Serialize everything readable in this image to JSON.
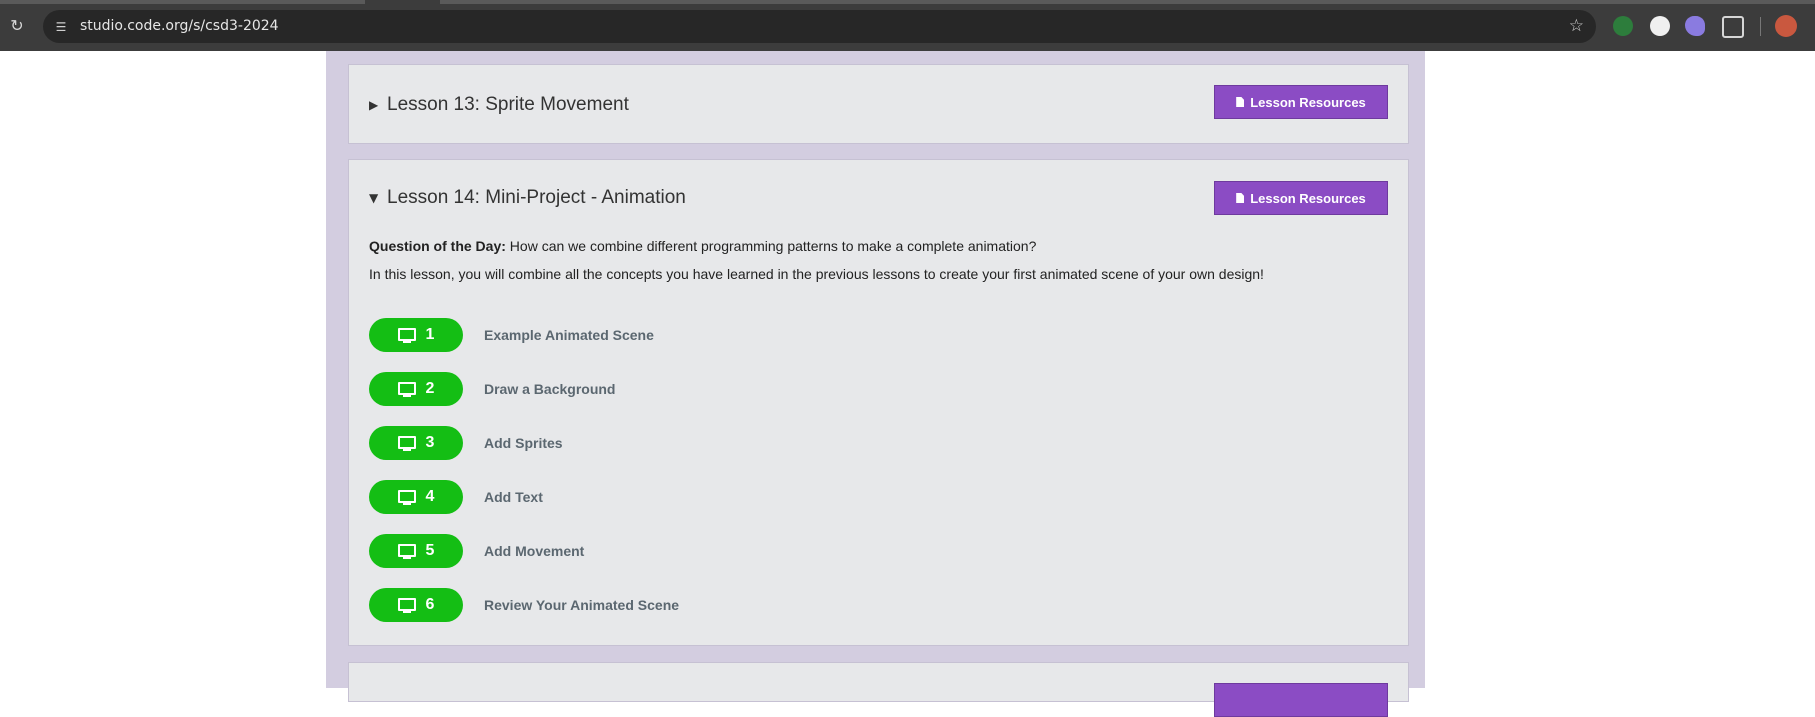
{
  "browser": {
    "url": "studio.code.org/s/csd3-2024"
  },
  "lessons": [
    {
      "title": "Lesson 13: Sprite Movement",
      "expanded": false,
      "resources_label": "Lesson Resources"
    },
    {
      "title": "Lesson 14: Mini-Project - Animation",
      "expanded": true,
      "resources_label": "Lesson Resources",
      "question_label": "Question of the Day:",
      "question_text": "How can we combine different programming patterns to make a complete animation?",
      "overview": "In this lesson, you will combine all the concepts you have learned in the previous lessons to create your first animated scene of your own design!",
      "levels": [
        {
          "number": "1",
          "name": "Example Animated Scene"
        },
        {
          "number": "2",
          "name": "Draw a Background"
        },
        {
          "number": "3",
          "name": "Add Sprites"
        },
        {
          "number": "4",
          "name": "Add Text"
        },
        {
          "number": "5",
          "name": "Add Movement"
        },
        {
          "number": "6",
          "name": "Review Your Animated Scene"
        }
      ]
    }
  ],
  "colors": {
    "page_bg": "#d3cde0",
    "card_bg": "#e7e8ea",
    "resource_button": "#8b4cc4",
    "level_bubble": "#14be14"
  },
  "icons": {
    "reload": "reload-icon",
    "site_info": "site-info-icon",
    "bookmark": "star-icon",
    "resources": "document-icon",
    "level": "monitor-icon"
  }
}
